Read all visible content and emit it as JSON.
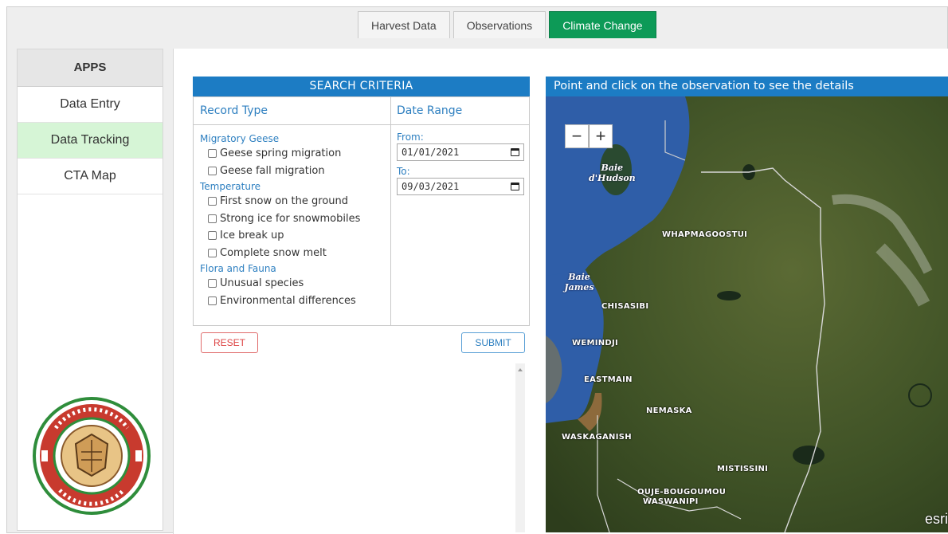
{
  "tabs": [
    {
      "label": "Harvest Data",
      "active": false
    },
    {
      "label": "Observations",
      "active": false
    },
    {
      "label": "Climate Change",
      "active": true
    }
  ],
  "sidebar": {
    "header": "APPS",
    "items": [
      {
        "label": "Data Entry",
        "active": false
      },
      {
        "label": "Data Tracking",
        "active": true
      },
      {
        "label": "CTA Map",
        "active": false
      }
    ],
    "logo_icon": "cree-trappers-association-logo-icon"
  },
  "search": {
    "header": "SEARCH CRITERIA",
    "record_type_title": "Record Type",
    "date_range_title": "Date Range",
    "groups": [
      {
        "label": "Migratory Geese",
        "options": [
          "Geese spring migration",
          "Geese fall migration"
        ]
      },
      {
        "label": "Temperature",
        "options": [
          "First snow on the ground",
          "Strong ice for snowmobiles",
          "Ice break up",
          "Complete snow melt"
        ]
      },
      {
        "label": "Flora and Fauna",
        "options": [
          "Unusual species",
          "Environmental differences"
        ]
      }
    ],
    "from_label": "From:",
    "from_value": "01/01/2021",
    "to_label": "To:",
    "to_value": "09/03/2021",
    "reset_label": "RESET",
    "submit_label": "SUBMIT"
  },
  "map": {
    "header": "Point and click on the observation to see the details",
    "zoom_out": "−",
    "zoom_in": "+",
    "water": [
      "Baie d'Hudson",
      "Baie James"
    ],
    "places": [
      "WHAPMAGOOSTUI",
      "CHISASIBI",
      "WEMINDJI",
      "EASTMAIN",
      "NEMASKA",
      "WASKAGANISH",
      "MISTISSINI",
      "OUJE-BOUGOUMOU",
      "WASWANIPI"
    ],
    "attribution": "esri"
  },
  "colors": {
    "active_tab": "#0d9a57",
    "header_blue": "#1c7cc4",
    "active_sidebar": "#d6f5d6",
    "reset_red": "#d44444"
  }
}
